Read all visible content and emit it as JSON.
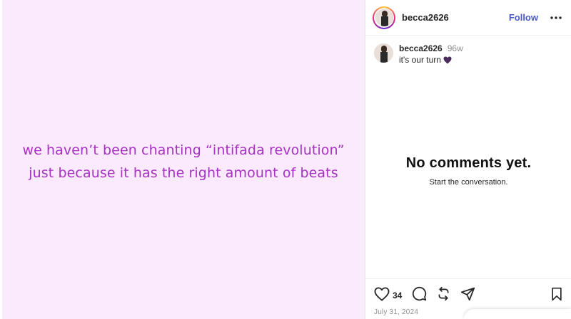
{
  "post": {
    "quote_line1": "we haven’t been chanting “intifada revolution”",
    "quote_line2": "just because it has the right amount of beats",
    "background_color": "#fbe9fe",
    "text_color": "#a631c2"
  },
  "header": {
    "username": "becca2626",
    "follow_label": "Follow",
    "more_icon": "more-horizontal-icon"
  },
  "caption": {
    "username": "becca2626",
    "time": "96w",
    "text": "it's our turn",
    "emoji": "purple-heart-icon"
  },
  "comments": {
    "empty_title": "No comments yet.",
    "empty_subtitle": "Start the conversation."
  },
  "actions": {
    "like_icon": "heart-icon",
    "like_count": "34",
    "comment_icon": "comment-icon",
    "repost_icon": "repost-icon",
    "share_icon": "share-icon",
    "save_icon": "bookmark-icon"
  },
  "footer": {
    "date": "July 31, 2024"
  },
  "colors": {
    "accent": "#4a5bc4",
    "muted": "#8e8e8e"
  }
}
